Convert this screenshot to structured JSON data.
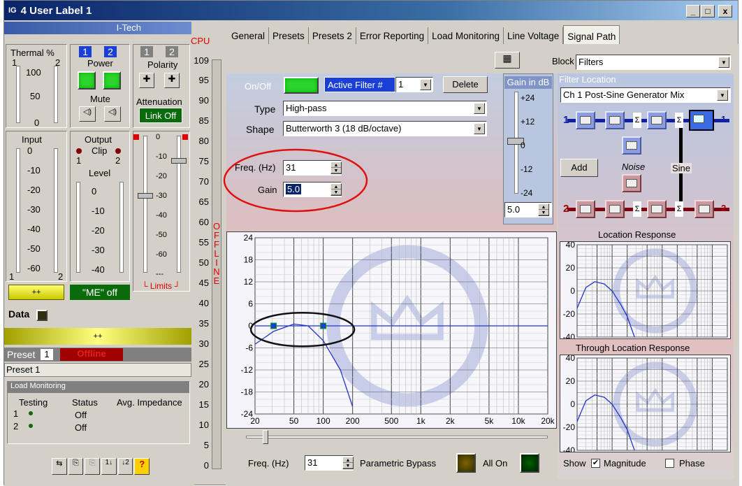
{
  "window": {
    "title": "4 User Label 1",
    "icon": "IG",
    "min": "_",
    "max": "□",
    "close": "x"
  },
  "left": {
    "brand": "I-Tech",
    "thermal": {
      "label": "Thermal %",
      "ch1": "1",
      "ch2": "2",
      "ticks": [
        "100",
        "50",
        "0"
      ]
    },
    "power": {
      "ch1": "1",
      "ch2": "2",
      "label": "Power"
    },
    "mute": {
      "label": "Mute"
    },
    "polarity": {
      "ch1": "1",
      "ch2": "2",
      "label": "Polarity"
    },
    "attenuation": {
      "label": "Attenuation",
      "link": "Link Off",
      "ticks": [
        "0",
        "-10",
        "-20",
        "-30",
        "-40",
        "-50",
        "-60",
        "---"
      ]
    },
    "input": {
      "label": "Input",
      "ch1": "1",
      "ch2": "2",
      "ticks": [
        "0",
        "-10",
        "-20",
        "-30",
        "-40",
        "-50",
        "-60"
      ]
    },
    "output": {
      "label": "Output",
      "clip": "Clip",
      "ch1": "1",
      "ch2": "2",
      "level": "Level",
      "ticks": [
        "0",
        "-10",
        "-20",
        "-30",
        "-40"
      ]
    },
    "limits": "Limits",
    "yellow_btn": "++",
    "me": "\"ME\" off",
    "data": "Data",
    "yellow_bar": "++",
    "preset": {
      "label": "Preset",
      "num": "1",
      "status": "Offline",
      "name": "Preset 1"
    },
    "load": {
      "title": "Load Monitoring",
      "cols": [
        "Testing",
        "Status",
        "Avg. Impedance"
      ],
      "rows": [
        {
          "n": "1",
          "s": "Off"
        },
        {
          "n": "2",
          "s": "Off"
        }
      ]
    }
  },
  "cpu": {
    "label": "CPU",
    "value": "109",
    "ticks": [
      "95",
      "90",
      "85",
      "80",
      "75",
      "70",
      "65",
      "60",
      "55",
      "50",
      "45",
      "40",
      "35",
      "30",
      "25",
      "20",
      "15",
      "10",
      "5",
      "0"
    ],
    "offline": "OFFLINE"
  },
  "tabs": [
    "General",
    "Presets",
    "Presets 2",
    "Error Reporting",
    "Load Monitoring",
    "Line Voltage",
    "Signal Path"
  ],
  "active_tab": "Signal Path",
  "block": {
    "label": "Block",
    "value": "Filters"
  },
  "filter": {
    "onoff": "On/Off",
    "active_label": "Active Filter #",
    "active_value": "1",
    "delete": "Delete",
    "type_label": "Type",
    "type": "High-pass",
    "shape_label": "Shape",
    "shape": "Butterworth 3 (18 dB/octave)",
    "freq_label": "Freq. (Hz)",
    "freq": "31",
    "gain_label": "Gain",
    "gain": "5.0"
  },
  "gain_db": {
    "label": "Gain in dB",
    "ticks": [
      "+24",
      "+12",
      "0",
      "-12",
      "-24"
    ],
    "value": "5.0"
  },
  "location": {
    "label": "Filter Location",
    "value": "Ch 1 Post-Sine Generator Mix",
    "add": "Add",
    "noise": "Noise",
    "sine": "Sine",
    "ch1": "1",
    "ch2": "2"
  },
  "main_chart": {
    "y_ticks": [
      "24",
      "18",
      "12",
      "6",
      "0",
      "-6",
      "-12",
      "-18",
      "-24"
    ],
    "x_ticks": [
      "20",
      "50",
      "100",
      "200",
      "500",
      "1k",
      "2k",
      "5k",
      "10k",
      "20k"
    ]
  },
  "loc_resp": {
    "title": "Location Response",
    "y_ticks": [
      "40",
      "20",
      "0",
      "-20",
      "-40"
    ]
  },
  "thru_resp": {
    "title": "Through Location Response",
    "y_ticks": [
      "40",
      "20",
      "0",
      "-20",
      "-40"
    ]
  },
  "bottom": {
    "freq_label": "Freq. (Hz)",
    "freq": "31",
    "bypass": "Parametric Bypass",
    "allon": "All On",
    "show": "Show",
    "magnitude": "Magnitude",
    "phase": "Phase"
  },
  "chart_data": {
    "type": "line",
    "xlabel": "",
    "ylabel": "",
    "x_scale": "log",
    "xlim": [
      20,
      20000
    ],
    "ylim": [
      -24,
      24
    ],
    "series": [
      {
        "values": [
          [
            20,
            0
          ],
          [
            31,
            0
          ],
          [
            100,
            0
          ],
          [
            20000,
            0
          ]
        ]
      },
      {
        "values": [
          [
            20,
            -5
          ],
          [
            31,
            -1.5
          ],
          [
            50,
            0.5
          ],
          [
            70,
            0
          ],
          [
            100,
            -4
          ],
          [
            150,
            -12
          ],
          [
            200,
            -22
          ]
        ]
      }
    ],
    "markers": [
      [
        31,
        0
      ],
      [
        100,
        0
      ]
    ]
  }
}
